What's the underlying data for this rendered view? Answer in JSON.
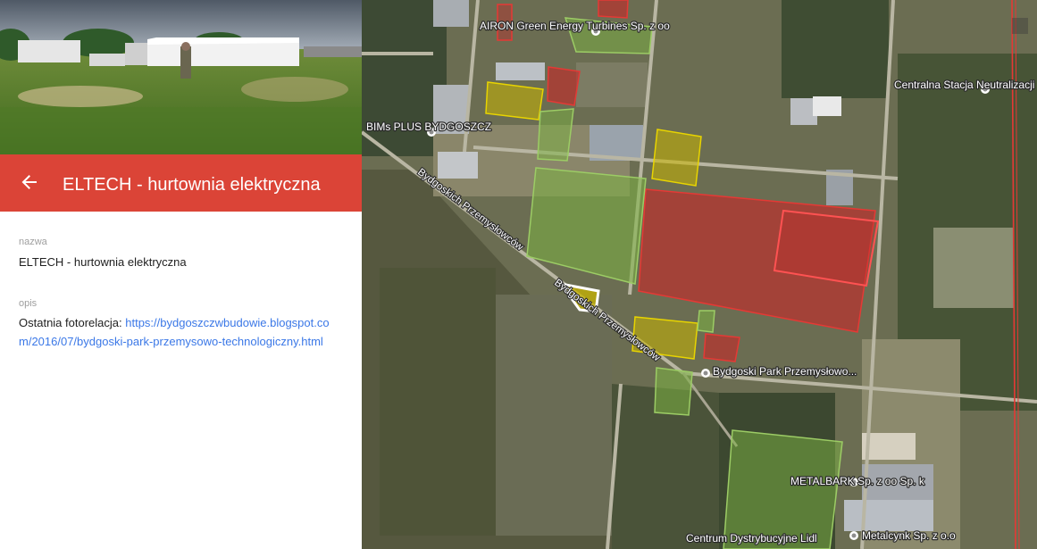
{
  "feature": {
    "title": "ELTECH - hurtownia elektryczna",
    "back_icon": "arrow-left-icon",
    "fields": [
      {
        "label": "nazwa",
        "value": "ELTECH - hurtownia elektryczna"
      },
      {
        "label": "opis",
        "value_prefix": "Ostatnia fotorelacja: ",
        "link": "https://bydgoszczwbudowie.blogspot.com/2016/07/bydgoski-park-przemysowo-technologiczny.html"
      }
    ]
  },
  "colors": {
    "header_bg": "#db4437",
    "zone_red": "#c62828",
    "zone_yellow": "#c8b400",
    "zone_green": "#7cb342",
    "selected_outline": "#ffffff",
    "link": "#3b78e7"
  },
  "map": {
    "labels": [
      "AIRON Green Energy Turbines Sp. z oo",
      "BIMs PLUS BYDGOSZCZ",
      "Centralna Stacja Neutralizacji",
      "Bydgoski Park Przemysłowo...",
      "METALBARK Sp. z oo Sp. k",
      "Centrum Dystrybucyjne Lidl",
      "Metalcynk Sp. z o.o"
    ],
    "road_label": "Bydgoskich Przemysłowców"
  }
}
